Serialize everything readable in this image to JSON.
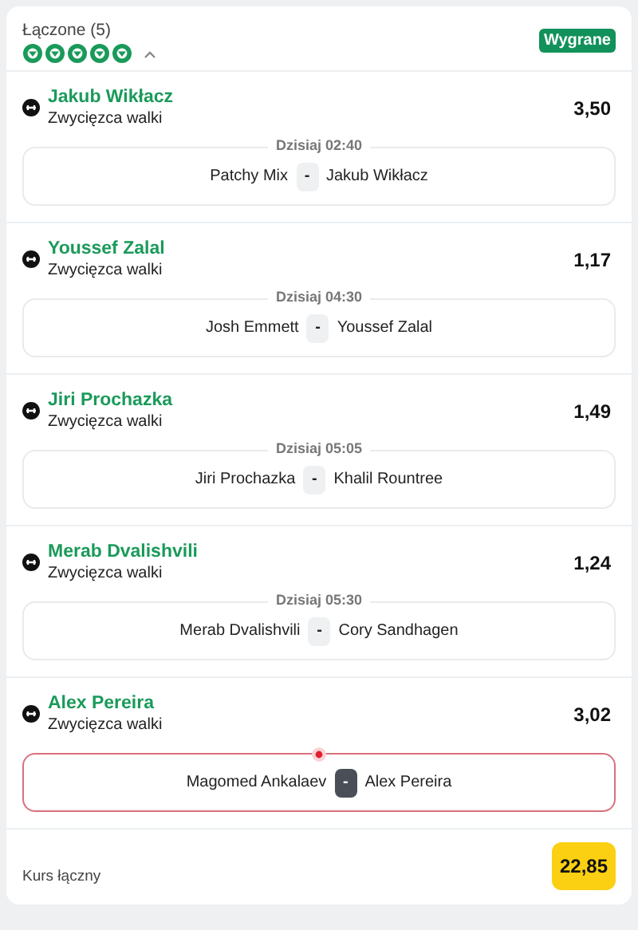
{
  "header": {
    "title": "Łączone (5)",
    "expanded": true,
    "status_badge": "Wygrane"
  },
  "selections": [
    {
      "name": "Jakub Wikłacz",
      "market": "Zwycięzca walki",
      "odds": "3,50",
      "won": true,
      "live": false,
      "time": "Dzisiaj 02:40",
      "home": "Patchy Mix",
      "separator": "-",
      "away": "Jakub Wikłacz"
    },
    {
      "name": "Youssef Zalal",
      "market": "Zwycięzca walki",
      "odds": "1,17",
      "won": true,
      "live": false,
      "time": "Dzisiaj 04:30",
      "home": "Josh Emmett",
      "separator": "-",
      "away": "Youssef Zalal"
    },
    {
      "name": "Jiri Prochazka",
      "market": "Zwycięzca walki",
      "odds": "1,49",
      "won": true,
      "live": false,
      "time": "Dzisiaj 05:05",
      "home": "Jiri Prochazka",
      "separator": "-",
      "away": "Khalil Rountree"
    },
    {
      "name": "Merab Dvalishvili",
      "market": "Zwycięzca walki",
      "odds": "1,24",
      "won": true,
      "live": false,
      "time": "Dzisiaj 05:30",
      "home": "Merab Dvalishvili",
      "separator": "-",
      "away": "Cory Sandhagen"
    },
    {
      "name": "Alex Pereira",
      "market": "Zwycięzca walki",
      "odds": "3,02",
      "won": true,
      "live": true,
      "home": "Magomed Ankalaev",
      "separator": "-",
      "away": "Alex Pereira"
    }
  ],
  "footer": {
    "label": "Kurs łączny",
    "total_odds": "22,85"
  }
}
